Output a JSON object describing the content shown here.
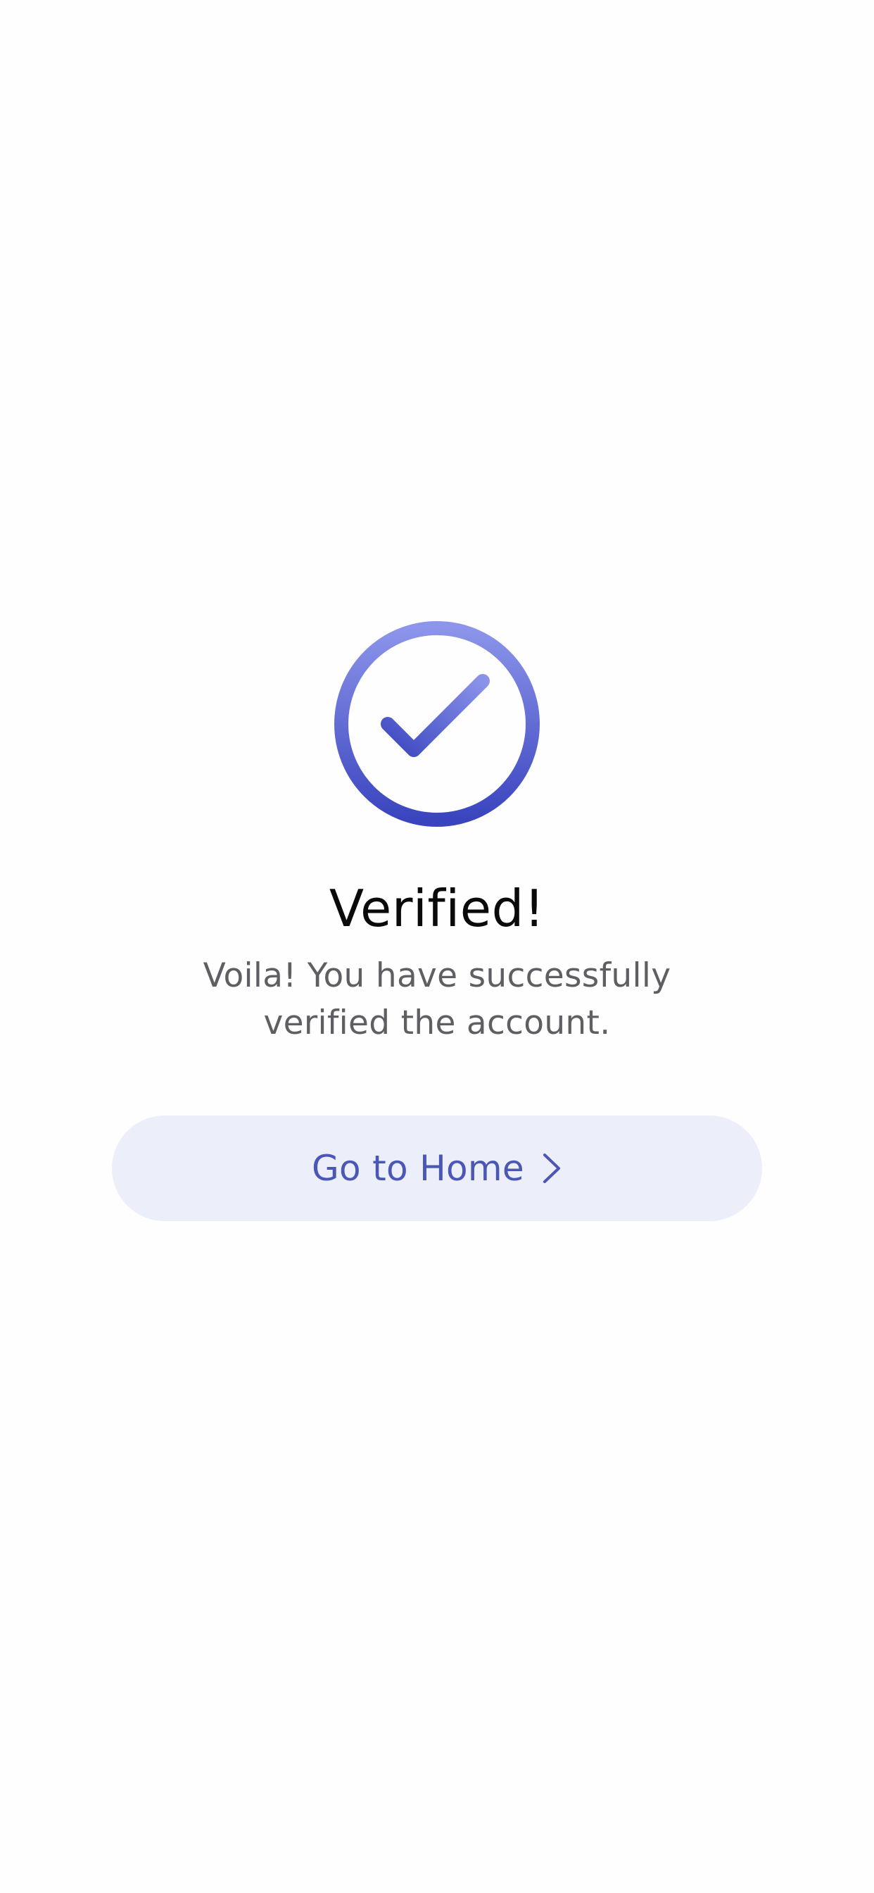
{
  "verification": {
    "title": "Verified!",
    "message": "Voila! You have successfully verified the account.",
    "status_icon": "check-circle-icon"
  },
  "actions": {
    "home_button_label": "Go to Home",
    "home_button_icon": "chevron-right-icon"
  },
  "colors": {
    "accent_light": "#8C95EA",
    "accent_dark": "#3A44BE",
    "button_background": "#ECEEF9",
    "button_text": "#4A57B5",
    "title_text": "#0A0A0A",
    "body_text": "#5F5F63"
  }
}
